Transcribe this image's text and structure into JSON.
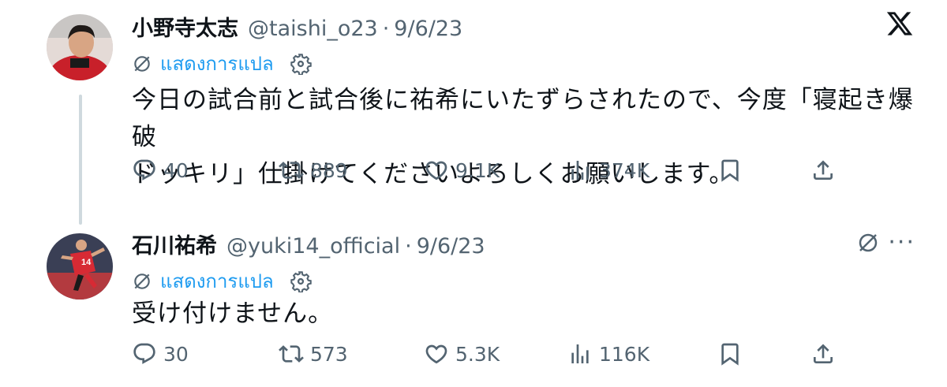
{
  "tweet1": {
    "name": "小野寺太志",
    "handle": "@taishi_o23",
    "dot": "·",
    "date": "9/6/23",
    "translate_label": "แสดงการแปล",
    "text_line1": "今日の試合前と試合後に祐希にいたずらされたので、今度「寝起き爆破",
    "text_line2": "ドッキリ」仕掛けてくださいよろしくお願いします。",
    "replies": "40",
    "reposts": "889",
    "likes": "9.1K",
    "views": "374K"
  },
  "tweet2": {
    "name": "石川祐希",
    "handle": "@yuki14_official",
    "dot": "·",
    "date": "9/6/23",
    "translate_label": "แสดงการแปล",
    "text_line1": "受け付けません。",
    "more_label": "···",
    "replies": "30",
    "reposts": "573",
    "likes": "5.3K",
    "views": "116K"
  },
  "colors": {
    "accent": "#1d9bf0",
    "muted": "#536471",
    "text": "#0f1419",
    "thread": "#cfd9de"
  }
}
